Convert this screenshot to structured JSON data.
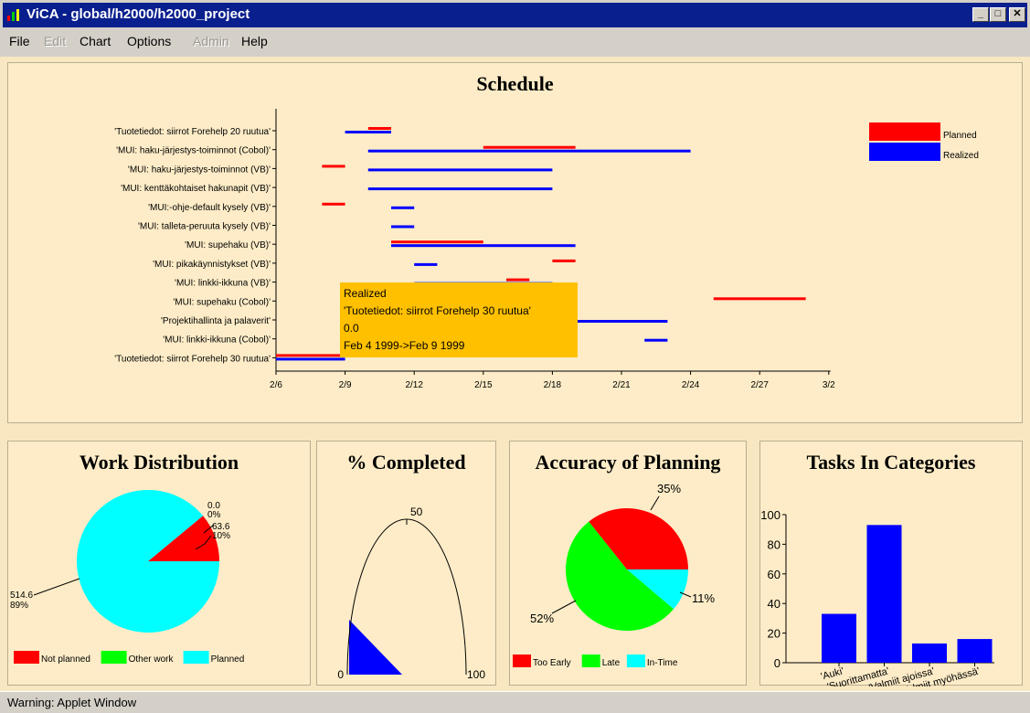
{
  "window": {
    "title": "ViCA - global/h2000/h2000_project",
    "minimize": "_",
    "maximize": "□",
    "close": "✕"
  },
  "menu": [
    {
      "label": "File",
      "enabled": true
    },
    {
      "label": "Edit",
      "enabled": false
    },
    {
      "label": "Chart",
      "enabled": true
    },
    {
      "label": "Options",
      "enabled": true
    },
    {
      "label": "Admin",
      "enabled": false
    },
    {
      "label": "Help",
      "enabled": true
    }
  ],
  "colors": {
    "planned": "#ff0000",
    "realized": "#0000ff",
    "other": "#00ff00",
    "cyan": "#00ffff",
    "tooltip": "#ffc000",
    "panel": "#fdecc7"
  },
  "schedule": {
    "title": "Schedule",
    "legend": {
      "planned": "Planned",
      "realized": "Realized"
    },
    "x_ticks": [
      "2/6",
      "2/9",
      "2/12",
      "2/15",
      "2/18",
      "2/21",
      "2/24",
      "2/27",
      "3/2"
    ],
    "tasks": [
      {
        "label": "'Tuotetiedot: siirrot Forehelp 20 ruutua'",
        "planned": [
          "Feb 10",
          "Feb 11"
        ],
        "realized": [
          "Feb 9",
          "Feb 11"
        ]
      },
      {
        "label": "'MUI: haku-järjestys-toiminnot (Cobol)'",
        "planned": [
          "Feb 15",
          "Feb 19"
        ],
        "realized": [
          "Feb 10",
          "Feb 24"
        ]
      },
      {
        "label": "'MUI: haku-järjestys-toiminnot (VB)'",
        "planned": [
          "Feb 8",
          "Feb 9"
        ],
        "realized": [
          "Feb 10",
          "Feb 18"
        ]
      },
      {
        "label": "'MUI: kenttäkohtaiset hakunapit (VB)'",
        "planned": null,
        "realized": [
          "Feb 10",
          "Feb 18"
        ]
      },
      {
        "label": "'MUI:-ohje-default kysely (VB)'",
        "planned": [
          "Feb 8",
          "Feb 9"
        ],
        "realized": [
          "Feb 11",
          "Feb 12"
        ]
      },
      {
        "label": "'MUI: talleta-peruuta  kysely (VB)'",
        "planned": null,
        "realized": [
          "Feb 11",
          "Feb 12"
        ]
      },
      {
        "label": "'MUI: supehaku (VB)'",
        "planned": [
          "Feb 11",
          "Feb 15"
        ],
        "realized": [
          "Feb 11",
          "Feb 19"
        ]
      },
      {
        "label": "'MUI: pikakäynnistykset (VB)'",
        "planned": [
          "Feb 18",
          "Feb 19"
        ],
        "realized": [
          "Feb 12",
          "Feb 13"
        ]
      },
      {
        "label": "'MUI: linkki-ikkuna (VB)'",
        "planned": [
          "Feb 16",
          "Feb 17"
        ],
        "realized": [
          "Feb 12",
          "Feb 18"
        ]
      },
      {
        "label": "'MUI: supehaku (Cobol)'",
        "planned": [
          "Feb 25",
          "Feb 29"
        ],
        "realized": null
      },
      {
        "label": "'Projektihallinta ja palaverit'",
        "planned": null,
        "realized": [
          "Feb 19",
          "Feb 23"
        ]
      },
      {
        "label": "'MUI: linkki-ikkuna (Cobol)'",
        "planned": null,
        "realized": [
          "Feb 22",
          "Feb 23"
        ]
      },
      {
        "label": "'Tuotetiedot: siirrot Forehelp 30 ruutua'",
        "planned": [
          "Feb 6",
          "Feb 9"
        ],
        "realized": [
          "Feb 6",
          "Feb 9"
        ]
      }
    ],
    "tooltip": {
      "lines": [
        "Realized",
        "'Tuotetiedot: siirrot Forehelp 30 ruutua'",
        "0.0",
        "Feb 4 1999->Feb 9 1999"
      ]
    }
  },
  "work_distribution": {
    "title": "Work Distribution",
    "slices": [
      {
        "name": "Other work",
        "value": 0.0,
        "value_label": "0.0",
        "pct_label": "0%",
        "color": "#00ff00"
      },
      {
        "name": "Not planned",
        "value": 63.6,
        "value_label": "63.6",
        "pct_label": "10%",
        "color": "#ff0000"
      },
      {
        "name": "Planned",
        "value": 514.6,
        "value_label": "514.6",
        "pct_label": "89%",
        "color": "#00ffff"
      }
    ],
    "legend": [
      {
        "label": "Not planned",
        "color": "#ff0000"
      },
      {
        "label": "Other work",
        "color": "#00ff00"
      },
      {
        "label": "Planned",
        "color": "#00ffff"
      }
    ]
  },
  "completed": {
    "title": "% Completed",
    "value": 0,
    "min_label": "0",
    "mid_label": "50",
    "max_label": "100"
  },
  "accuracy": {
    "title": "Accuracy of Planning",
    "slices": [
      {
        "name": "Too Early",
        "percent": 35,
        "label": "35%",
        "color": "#ff0000"
      },
      {
        "name": "In-Time",
        "percent": 11,
        "label": "11%",
        "color": "#00ffff"
      },
      {
        "name": "Late",
        "percent": 52,
        "label": "52%",
        "color": "#00ff00"
      }
    ],
    "legend": [
      {
        "label": "Too Early",
        "color": "#ff0000"
      },
      {
        "label": "Late",
        "color": "#00ff00"
      },
      {
        "label": "In-Time",
        "color": "#00ffff"
      }
    ]
  },
  "categories": {
    "title": "Tasks In Categories",
    "y_ticks": [
      "0",
      "20",
      "40",
      "60",
      "80",
      "100"
    ],
    "ylim": [
      0,
      100
    ]
  },
  "chart_data": [
    {
      "type": "bar",
      "title": "Tasks In Categories",
      "categories": [
        "'Auki'",
        "'Suorittamatta'",
        "'Valmiit ajoissa'",
        "'Valmiit myöhässä'"
      ],
      "values": [
        33,
        93,
        13,
        16
      ],
      "ylim": [
        0,
        100
      ],
      "grid": false
    },
    {
      "type": "pie",
      "title": "Work Distribution",
      "categories": [
        "Other work",
        "Not planned",
        "Planned"
      ],
      "values": [
        0.0,
        63.6,
        514.6
      ]
    },
    {
      "type": "pie",
      "title": "Accuracy of Planning",
      "categories": [
        "Too Early",
        "Late",
        "In-Time"
      ],
      "values": [
        35,
        52,
        11
      ]
    }
  ],
  "status": {
    "text": "Warning: Applet Window"
  }
}
